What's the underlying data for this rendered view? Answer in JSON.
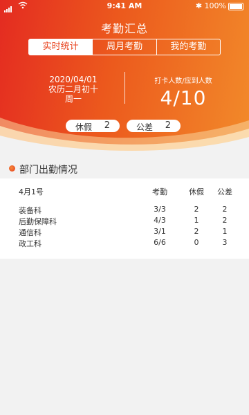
{
  "status": {
    "time": "9:41 AM",
    "battery": "100%"
  },
  "header": {
    "title": "考勤汇总"
  },
  "tabs": [
    "实时统计",
    "周月考勤",
    "我的考勤"
  ],
  "date_info": {
    "date": "2020/04/01",
    "lunar": "农历二月初十",
    "weekday": "周一"
  },
  "clock_in": {
    "label": "打卡人数/应到人数",
    "value": "4/10"
  },
  "pills": [
    {
      "label": "休假",
      "value": "2"
    },
    {
      "label": "公差",
      "value": "2"
    }
  ],
  "section": {
    "title": "部门出勤情况"
  },
  "table": {
    "headers": [
      "4月1号",
      "考勤",
      "休假",
      "公差"
    ],
    "rows": [
      [
        "装备科",
        "3/3",
        "2",
        "2"
      ],
      [
        "后勤保障科",
        "4/3",
        "1",
        "2"
      ],
      [
        "通信科",
        "3/1",
        "2",
        "1"
      ],
      [
        "政工科",
        "6/6",
        "0",
        "3"
      ]
    ]
  },
  "colors": {
    "accent": "#e8421d",
    "gradient_start": "#e42b21",
    "gradient_end": "#f28a2a"
  }
}
